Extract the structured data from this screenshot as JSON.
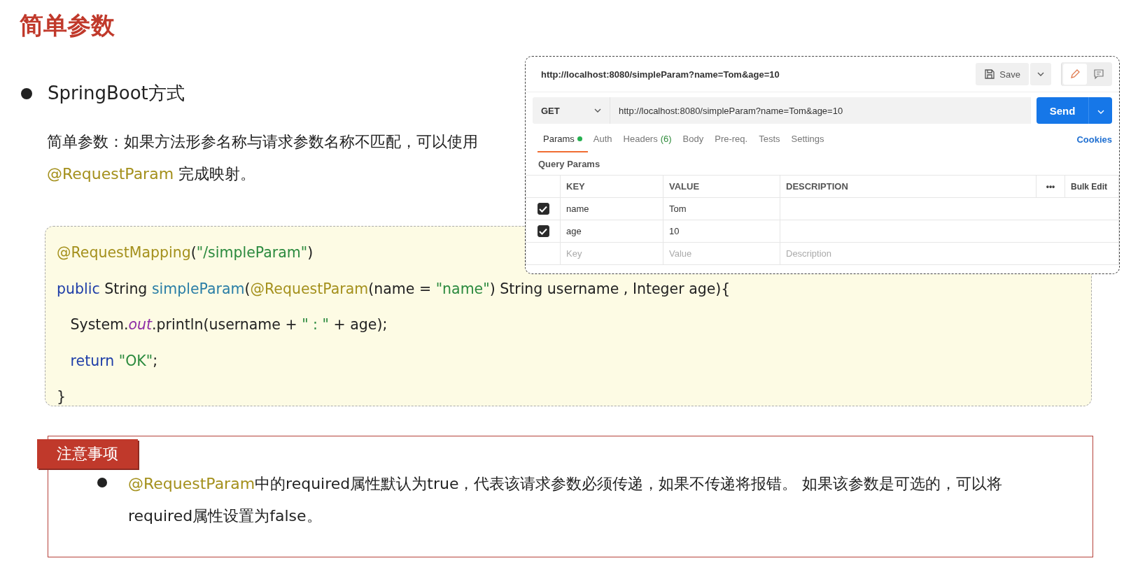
{
  "title": "简单参数",
  "bullet": "SpringBoot方式",
  "paragraph": [
    {
      "kind": "plain",
      "text": "简单参数：如果方法形参名称与请求参数名称不匹配，可以使用 "
    },
    {
      "kind": "annotation",
      "text": "@RequestParam"
    },
    {
      "kind": "plain",
      "text": " 完成映射。"
    }
  ],
  "code_lines": [
    [
      {
        "kind": "annotation",
        "text": "@RequestMapping"
      },
      {
        "kind": "plain",
        "text": "("
      },
      {
        "kind": "string",
        "text": "\"/simpleParam\""
      },
      {
        "kind": "plain",
        "text": ")"
      }
    ],
    [
      {
        "kind": "keyword",
        "text": "public"
      },
      {
        "kind": "plain",
        "text": " String "
      },
      {
        "kind": "method",
        "text": "simpleParam"
      },
      {
        "kind": "plain",
        "text": "("
      },
      {
        "kind": "annotation",
        "text": "@RequestParam"
      },
      {
        "kind": "plain",
        "text": "(name = "
      },
      {
        "kind": "string",
        "text": "\"name\""
      },
      {
        "kind": "plain",
        "text": ") String username , Integer age){"
      }
    ],
    [
      {
        "kind": "plain",
        "text": "   System."
      },
      {
        "kind": "field",
        "text": "out"
      },
      {
        "kind": "plain",
        "text": ".println(username + "
      },
      {
        "kind": "string",
        "text": "\" : \""
      },
      {
        "kind": "plain",
        "text": " + age);"
      }
    ],
    [
      {
        "kind": "keyword",
        "text": "   return "
      },
      {
        "kind": "string",
        "text": "\"OK\""
      },
      {
        "kind": "plain",
        "text": ";"
      }
    ],
    [
      {
        "kind": "plain",
        "text": "}"
      }
    ]
  ],
  "postman": {
    "header_url": "http://localhost:8080/simpleParam?name=Tom&age=10",
    "save": "Save",
    "method": "GET",
    "url": "http://localhost:8080/simpleParam?name=Tom&age=10",
    "send": "Send",
    "tabs": [
      {
        "label": "Params",
        "selected": true,
        "dot": true
      },
      {
        "label": "Auth",
        "selected": false
      },
      {
        "label": "Headers",
        "count": "(6)",
        "selected": false
      },
      {
        "label": "Body",
        "selected": false
      },
      {
        "label": "Pre-req.",
        "selected": false
      },
      {
        "label": "Tests",
        "selected": false
      },
      {
        "label": "Settings",
        "selected": false
      }
    ],
    "cookies": "Cookies",
    "section": "Query Params",
    "columns": [
      "KEY",
      "VALUE",
      "DESCRIPTION"
    ],
    "more": "•••",
    "bulk_edit": "Bulk Edit",
    "rows": [
      {
        "key": "name",
        "value": "Tom",
        "checked": true
      },
      {
        "key": "age",
        "value": "10",
        "checked": true
      }
    ],
    "new_row": [
      {
        "placeholder": "Key"
      },
      {
        "placeholder": "Value"
      },
      {
        "placeholder": "Description"
      }
    ]
  },
  "note": {
    "tag": "注意事项",
    "text": [
      {
        "kind": "annotation",
        "text": "@RequestParam"
      },
      {
        "kind": "plain",
        "text": "中的required属性默认为true，代表该请求参数必须传递，如果不传递将报错。 如果该参数是可选的，可以将required属性设置为false。"
      }
    ]
  }
}
